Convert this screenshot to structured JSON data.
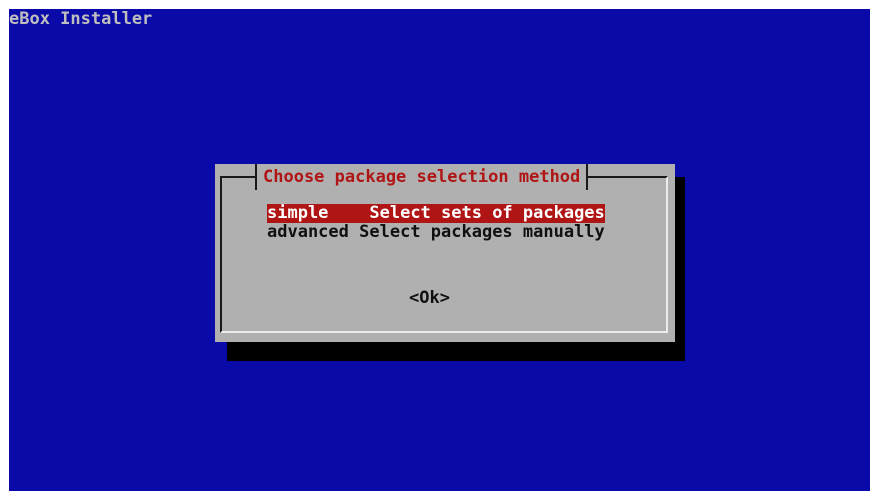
{
  "app": {
    "title": "eBox Installer"
  },
  "dialog": {
    "title": "Choose package selection method",
    "options": [
      {
        "tag": "simple  ",
        "description": "Select sets of packages",
        "selected": true
      },
      {
        "tag": "advanced",
        "description": "Select packages manually",
        "selected": false
      }
    ],
    "ok_label": "<Ok>"
  },
  "colors": {
    "background": "#0a0aa8",
    "dialog": "#b0b0b0",
    "accent": "#b01515",
    "shadow": "#000000"
  }
}
